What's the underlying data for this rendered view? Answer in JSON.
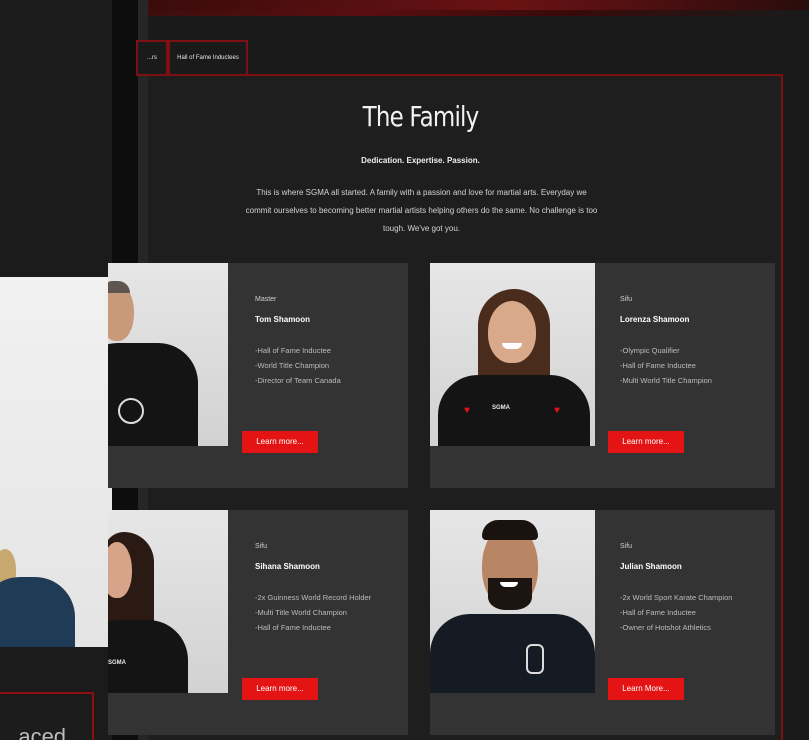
{
  "tabs": [
    "...rs",
    "Hall of Fame Inductees"
  ],
  "section": {
    "title": "The Family",
    "tagline": "Dedication. Expertise. Passion.",
    "intro": "This is where SGMA all started. A family with a passion and love for martial arts. Everyday we commit ourselves to becoming better martial artists helping others do the same. No challenge is too tough. We've got you."
  },
  "left_panel": {
    "bottom_text": "...aced"
  },
  "members": [
    {
      "role": "Master",
      "name": "Tom Shamoon",
      "facts": [
        "-Hall of Fame Inductee",
        "-World Title Champion",
        "-Director of Team Canada"
      ],
      "button": "Learn more..."
    },
    {
      "role": "Sifu",
      "name": "Lorenza Shamoon",
      "facts": [
        "-Olympic Qualifier",
        "-Hall of Fame Inductee",
        "-Multi World Title Champion"
      ],
      "button": "Learn more..."
    },
    {
      "role": "Sifu",
      "name": "Sihana Shamoon",
      "facts": [
        "-2x Guinness World Record Holder",
        "-Multi Title World Champion",
        "-Hall of Fame Inductee"
      ],
      "button": "Learn more..."
    },
    {
      "role": "Sifu",
      "name": "Julian Shamoon",
      "facts": [
        "-2x World Sport Karate Champion",
        "-Hall of Fame Inductee",
        "-Owner of Hotshot Athletics"
      ],
      "button": "Learn More..."
    }
  ],
  "shirt_text": "SGMA",
  "colors": {
    "accent": "#e41414",
    "border": "#7e1013",
    "card": "#333333",
    "background": "#1e1e1e"
  }
}
